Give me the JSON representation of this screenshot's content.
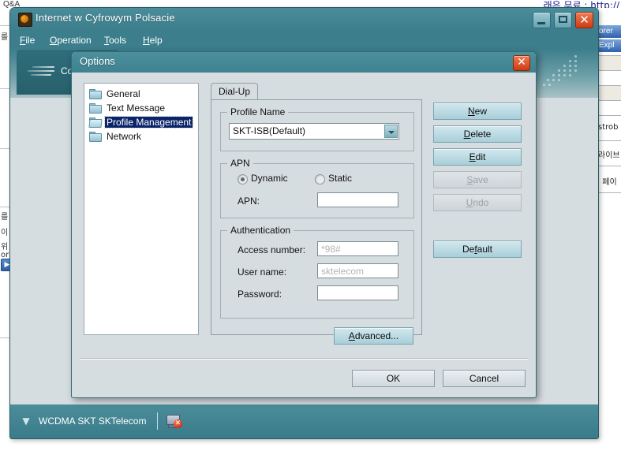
{
  "background": {
    "top_text": "래은 무료 : http://",
    "tab_left": "Q&A",
    "left_items": [
      "를 그",
      "를",
      "이",
      "위",
      "or"
    ],
    "right_panel": {
      "header1": "orer",
      "header2": "Expl",
      "cells": [
        "strob",
        "라이브",
        "페이"
      ]
    }
  },
  "app": {
    "title": "Internet w Cyfrowym Polsacie",
    "icon": "globe-icon",
    "menus": [
      {
        "pre": "",
        "key": "F",
        "post": "ile"
      },
      {
        "pre": "",
        "key": "O",
        "post": "peration"
      },
      {
        "pre": "",
        "key": "T",
        "post": "ools"
      },
      {
        "pre": "",
        "key": "H",
        "post": "elp"
      }
    ],
    "connect_tab_label": "Connect",
    "window_buttons": {
      "minimize": "minimize-icon",
      "maximize": "maximize-icon",
      "close": "✕"
    },
    "statusbar": {
      "signal_icon": "signal-icon",
      "text": "WCDMA  SKT SKTelecom",
      "network_icon": "network-disconnected-icon",
      "network_badge": "✕"
    }
  },
  "dialog": {
    "title": "Options",
    "close_label": "✕",
    "tree": [
      {
        "label": "General",
        "selected": false,
        "icon": "folder-icon"
      },
      {
        "label": "Text Message",
        "selected": false,
        "icon": "folder-icon"
      },
      {
        "label": "Profile Management",
        "selected": true,
        "icon": "folder-open-icon"
      },
      {
        "label": "Network",
        "selected": false,
        "icon": "folder-icon"
      }
    ],
    "tab": {
      "label": "Dial-Up"
    },
    "profile_group": {
      "title": "Profile Name",
      "value": "SKT-ISB(Default)",
      "dropdown_icon": "chevron-down-icon"
    },
    "apn_group": {
      "title": "APN",
      "dynamic_label": "Dynamic",
      "static_label": "Static",
      "selected": "Dynamic",
      "apn_label": "APN:",
      "apn_value": ""
    },
    "auth_group": {
      "title": "Authentication",
      "access_number_label": "Access number:",
      "access_number_value": "*98#",
      "user_name_label": "User name:",
      "user_name_value": "sktelecom",
      "password_label": "Password:",
      "password_value": ""
    },
    "advanced_button": {
      "pre": "",
      "key": "A",
      "post": "dvanced..."
    },
    "side_buttons": [
      {
        "pre": "",
        "key": "N",
        "post": "ew",
        "disabled": false
      },
      {
        "pre": "",
        "key": "D",
        "post": "elete",
        "disabled": false
      },
      {
        "pre": "",
        "key": "E",
        "post": "dit",
        "disabled": false
      },
      {
        "pre": "",
        "key": "S",
        "post": "ave",
        "disabled": true
      },
      {
        "pre": "",
        "key": "U",
        "post": "ndo",
        "disabled": true
      }
    ],
    "default_button": {
      "pre": "De",
      "key": "f",
      "post": "ault"
    },
    "ok_button": "OK",
    "cancel_button": "Cancel"
  },
  "colors": {
    "teal_title": "#3e8190",
    "dialog_face": "#d6dde0",
    "selection_blue": "#0a246a",
    "close_red": "#cf3b12",
    "button_blue": "#a8cfda"
  }
}
